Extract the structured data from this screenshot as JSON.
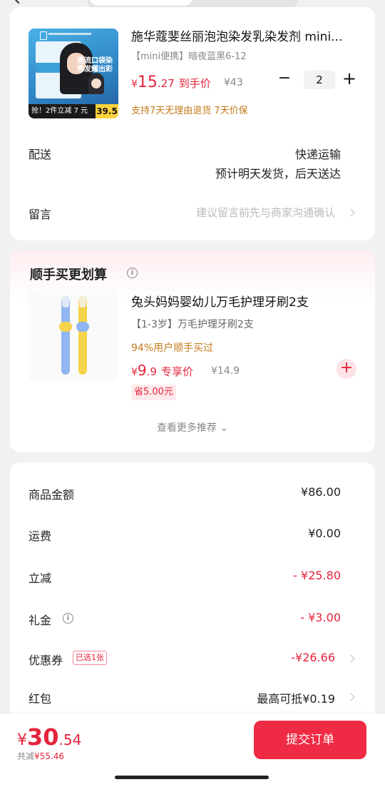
{
  "product": {
    "title": "施华蔻斐丝丽泡泡染发乳染发剂 mini...",
    "spec": "【mini便携】暗夜蓝黑6-12",
    "price_currency": "¥",
    "price_int": "15",
    "price_dec": ".27",
    "price_tag": "到手价",
    "orig_price": "¥43",
    "qty_minus": "−",
    "quantity": "2",
    "qty_plus": "+",
    "guarantee": "支持7天无理由退货 7天价保",
    "thumb_promo": "潮流口袋染 秀发耀出彩",
    "thumb_badge_num": "15",
    "thumb_band": "抢！2件立减 7 元",
    "thumb_price": "39.5"
  },
  "delivery": {
    "label": "配送",
    "method": "快递运输",
    "eta": "预计明天发货，后天送达"
  },
  "message": {
    "label": "留言",
    "placeholder": "建议留言前先与商家沟通确认"
  },
  "addon": {
    "section_title": "顺手买更划算",
    "title": "兔头妈妈婴幼儿万毛护理牙刷2支",
    "spec": "【1-3岁】万毛护理牙刷2支",
    "percent": "94%用户顺手买过",
    "price_currency": "¥",
    "price_int": "9",
    "price_dec": ".9",
    "price_tag": "专享价",
    "orig_price": "¥14.9",
    "save": "省5.00元",
    "add_symbol": "+",
    "more": "查看更多推荐 ⌄"
  },
  "summary": {
    "rows": [
      {
        "label": "商品金额",
        "value": "¥86.00"
      },
      {
        "label": "运费",
        "value": "¥0.00"
      },
      {
        "label": "立减",
        "value": "- ¥25.80"
      },
      {
        "label": "礼金",
        "value": "- ¥3.00"
      },
      {
        "label": "优惠券",
        "value": "-¥26.66"
      },
      {
        "label": "红包",
        "value": "最高可抵¥0.19"
      }
    ],
    "coupon_tag": "已选1张"
  },
  "footer": {
    "total_currency": "¥",
    "total_int": "30",
    "total_dec": ".54",
    "saved_label": "共减",
    "saved_value": "¥55.46",
    "submit": "提交订单"
  },
  "colors": {
    "accent": "#e5243b",
    "submit_bg": "#ee2a44",
    "guarantee": "#c27a1a",
    "background": "#f1f1f1"
  }
}
